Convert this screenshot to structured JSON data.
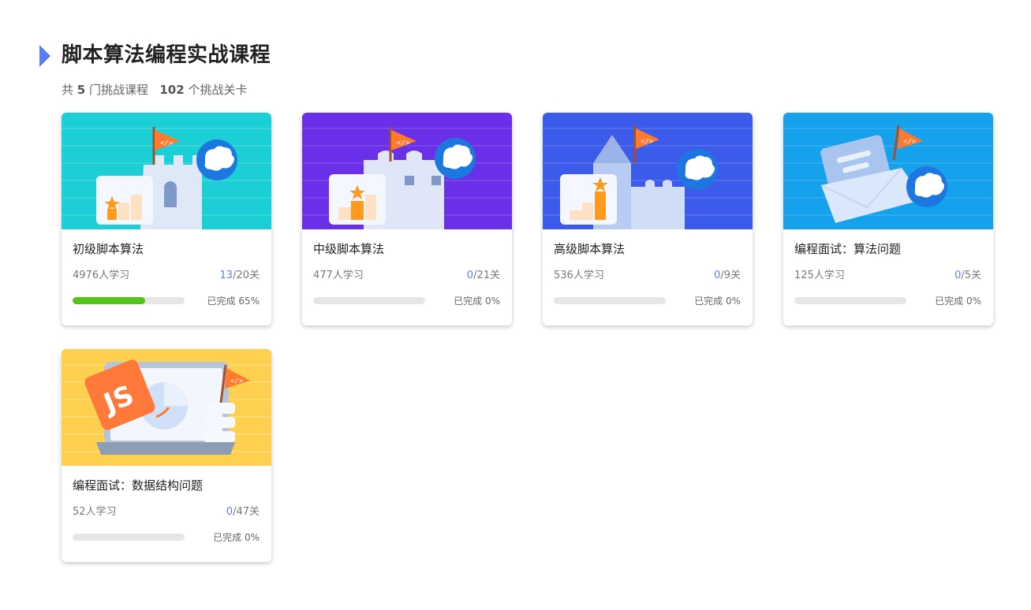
{
  "header": {
    "title": "脚本算法编程实战课程",
    "subtitle_prefix": "共",
    "course_count": "5",
    "course_suffix": "门挑战课程",
    "level_count": "102",
    "level_suffix": "个挑战关卡"
  },
  "colors": {
    "accent": "#5b7cf6",
    "progress": "#52c41a",
    "track": "#e6e6e6"
  },
  "courses": [
    {
      "title": "初级脚本算法",
      "learners": "4976人学习",
      "done": "13",
      "total": "/20关",
      "complete": "已完成 65%",
      "progress": 0.65,
      "banner_color": "#1ccfd6",
      "illustration": "castle-tower"
    },
    {
      "title": "中级脚本算法",
      "learners": "477人学习",
      "done": "0",
      "total": "/21关",
      "complete": "已完成 0%",
      "progress": 0,
      "banner_color": "#6a2fe8",
      "illustration": "castle-wall"
    },
    {
      "title": "高级脚本算法",
      "learners": "536人学习",
      "done": "0",
      "total": "/9关",
      "complete": "已完成 0%",
      "progress": 0,
      "banner_color": "#3d5bea",
      "illustration": "castle-spire"
    },
    {
      "title": "编程面试：算法问题",
      "learners": "125人学习",
      "done": "0",
      "total": "/5关",
      "complete": "已完成 0%",
      "progress": 0,
      "banner_color": "#16a1ec",
      "illustration": "envelope"
    },
    {
      "title": "编程面试：数据结构问题",
      "learners": "52人学习",
      "done": "0",
      "total": "/47关",
      "complete": "已完成 0%",
      "progress": 0,
      "banner_color": "#fdd04f",
      "illustration": "js-laptop",
      "badge_text": "JS"
    }
  ]
}
